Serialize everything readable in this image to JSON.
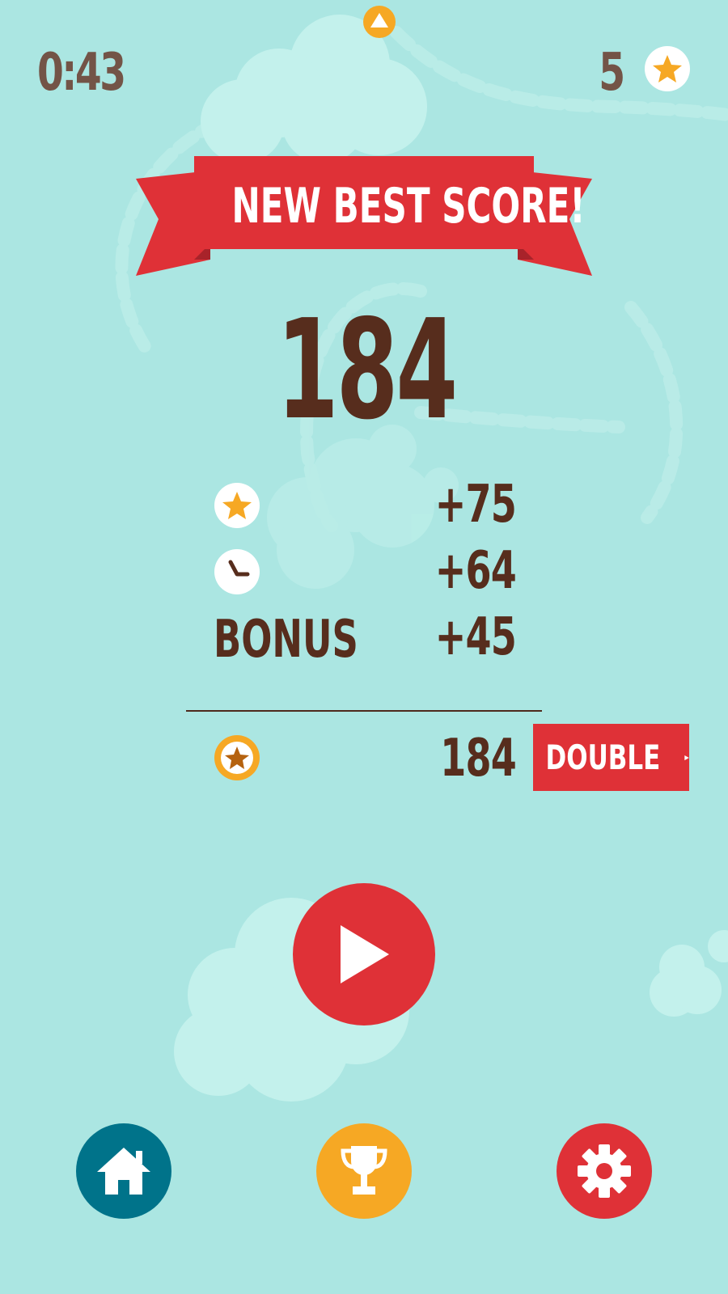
{
  "hud": {
    "timer": "0:43",
    "star_count": "5"
  },
  "banner": {
    "title": "NEW BEST SCORE!"
  },
  "score": {
    "total": "184"
  },
  "breakdown": [
    {
      "icon": "star-icon",
      "value": "+75"
    },
    {
      "icon": "clock-icon",
      "value": "+64"
    },
    {
      "label": "BONUS",
      "value": "+45"
    }
  ],
  "coins": {
    "icon": "coin-star-icon",
    "value": "184",
    "double_label": "DOUBLE"
  },
  "colors": {
    "background": "#ABE6E2",
    "red": "#DF3137",
    "brown": "#572D1D",
    "orange": "#F6A824",
    "teal": "#00738A"
  },
  "nav": {
    "home": "home-icon",
    "leaderboard": "trophy-icon",
    "settings": "gear-icon"
  }
}
